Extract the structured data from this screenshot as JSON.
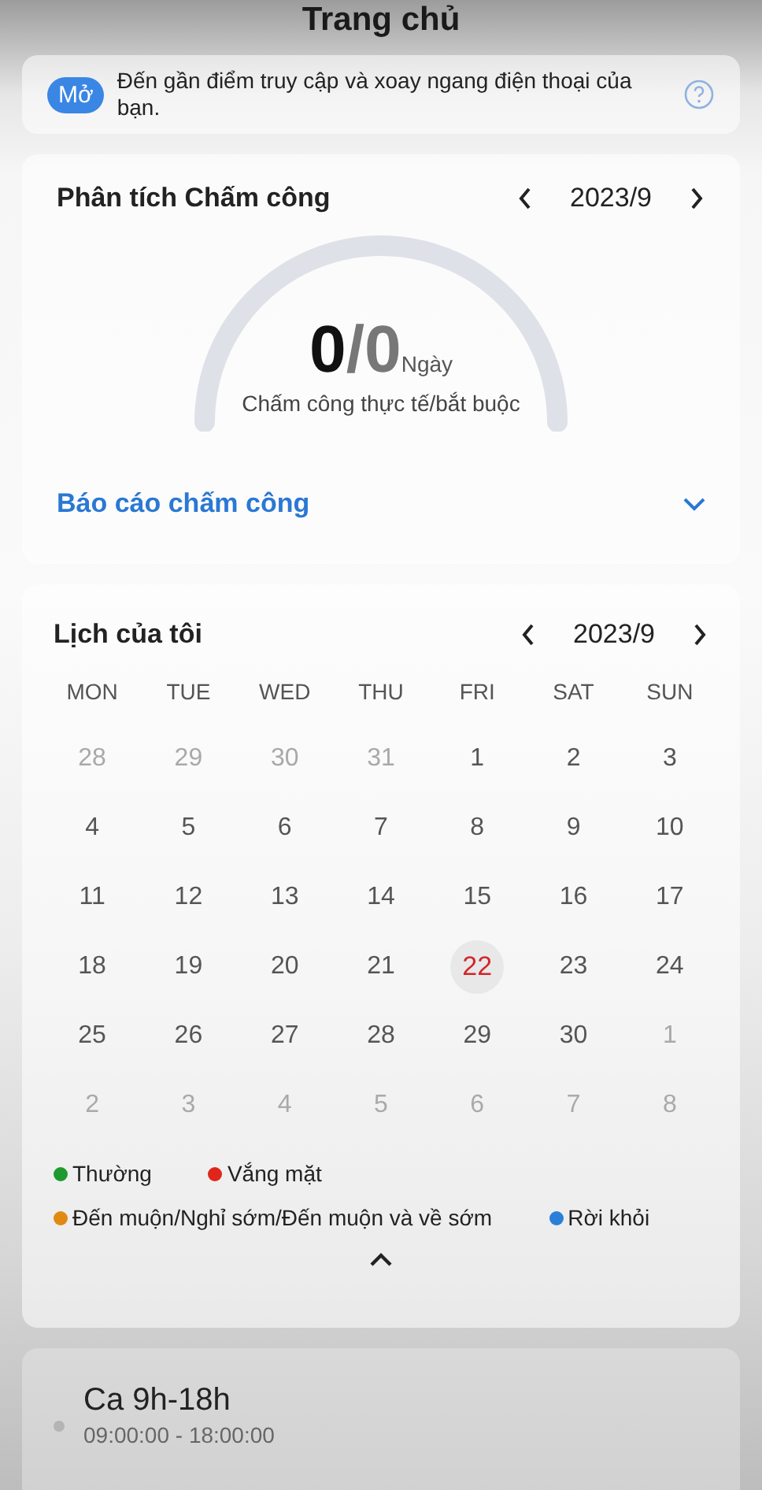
{
  "header": {
    "title": "Trang chủ"
  },
  "banner": {
    "badge": "Mở",
    "text": "Đến gần điểm truy cập và xoay ngang điện thoại của bạn."
  },
  "analysis": {
    "title": "Phân tích Chấm công",
    "month": "2023/9",
    "actual": "0",
    "separator": "/",
    "required": "0",
    "unit": "Ngày",
    "caption": "Chấm công thực tế/bắt buộc",
    "report_link": "Báo cáo chấm công"
  },
  "calendar": {
    "title": "Lịch của tôi",
    "month": "2023/9",
    "weekdays": [
      "MON",
      "TUE",
      "WED",
      "THU",
      "FRI",
      "SAT",
      "SUN"
    ],
    "weeks": [
      [
        {
          "day": "28",
          "muted": true,
          "selected": false
        },
        {
          "day": "29",
          "muted": true,
          "selected": false
        },
        {
          "day": "30",
          "muted": true,
          "selected": false
        },
        {
          "day": "31",
          "muted": true,
          "selected": false
        },
        {
          "day": "1",
          "muted": false,
          "selected": false
        },
        {
          "day": "2",
          "muted": false,
          "selected": false
        },
        {
          "day": "3",
          "muted": false,
          "selected": false
        }
      ],
      [
        {
          "day": "4",
          "muted": false,
          "selected": false
        },
        {
          "day": "5",
          "muted": false,
          "selected": false
        },
        {
          "day": "6",
          "muted": false,
          "selected": false
        },
        {
          "day": "7",
          "muted": false,
          "selected": false
        },
        {
          "day": "8",
          "muted": false,
          "selected": false
        },
        {
          "day": "9",
          "muted": false,
          "selected": false
        },
        {
          "day": "10",
          "muted": false,
          "selected": false
        }
      ],
      [
        {
          "day": "11",
          "muted": false,
          "selected": false
        },
        {
          "day": "12",
          "muted": false,
          "selected": false
        },
        {
          "day": "13",
          "muted": false,
          "selected": false
        },
        {
          "day": "14",
          "muted": false,
          "selected": false
        },
        {
          "day": "15",
          "muted": false,
          "selected": false
        },
        {
          "day": "16",
          "muted": false,
          "selected": false
        },
        {
          "day": "17",
          "muted": false,
          "selected": false
        }
      ],
      [
        {
          "day": "18",
          "muted": false,
          "selected": false
        },
        {
          "day": "19",
          "muted": false,
          "selected": false
        },
        {
          "day": "20",
          "muted": false,
          "selected": false
        },
        {
          "day": "21",
          "muted": false,
          "selected": false
        },
        {
          "day": "22",
          "muted": false,
          "selected": true
        },
        {
          "day": "23",
          "muted": false,
          "selected": false
        },
        {
          "day": "24",
          "muted": false,
          "selected": false
        }
      ],
      [
        {
          "day": "25",
          "muted": false,
          "selected": false
        },
        {
          "day": "26",
          "muted": false,
          "selected": false
        },
        {
          "day": "27",
          "muted": false,
          "selected": false
        },
        {
          "day": "28",
          "muted": false,
          "selected": false
        },
        {
          "day": "29",
          "muted": false,
          "selected": false
        },
        {
          "day": "30",
          "muted": false,
          "selected": false
        },
        {
          "day": "1",
          "muted": true,
          "selected": false
        }
      ],
      [
        {
          "day": "2",
          "muted": true,
          "selected": false
        },
        {
          "day": "3",
          "muted": true,
          "selected": false
        },
        {
          "day": "4",
          "muted": true,
          "selected": false
        },
        {
          "day": "5",
          "muted": true,
          "selected": false
        },
        {
          "day": "6",
          "muted": true,
          "selected": false
        },
        {
          "day": "7",
          "muted": true,
          "selected": false
        },
        {
          "day": "8",
          "muted": true,
          "selected": false
        }
      ]
    ],
    "legend": [
      {
        "label": "Thường",
        "color": "#1e9a2e"
      },
      {
        "label": "Vắng mặt",
        "color": "#e0261b"
      },
      {
        "label": "Đến muộn/Nghỉ sớm/Đến muộn và về sớm",
        "color": "#e08a12"
      },
      {
        "label": "Rời khỏi",
        "color": "#2b7fd8"
      }
    ]
  },
  "shift": {
    "name": "Ca 9h-18h",
    "time": "09:00:00 - 18:00:00",
    "color": "#b4b4b4"
  }
}
